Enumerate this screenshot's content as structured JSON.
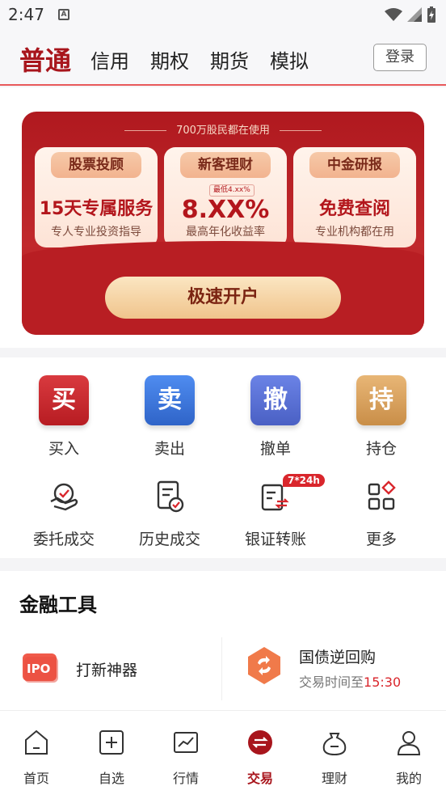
{
  "status_bar": {
    "time": "2:47",
    "notification_letter": "A"
  },
  "top_nav": {
    "tabs": [
      {
        "label": "普通",
        "active": true
      },
      {
        "label": "信用"
      },
      {
        "label": "期权"
      },
      {
        "label": "期货"
      },
      {
        "label": "模拟"
      }
    ],
    "login_label": "登录"
  },
  "banner": {
    "tagline": "700万股民都在使用",
    "cards": [
      {
        "title": "股票投顾",
        "main": "15天专属服务",
        "sub": "专人专业投资指导"
      },
      {
        "title": "新客理财",
        "mini": "最低4.xx%",
        "main": "8.XX%",
        "sub": "最高年化收益率"
      },
      {
        "title": "中金研报",
        "main": "免费查阅",
        "sub": "专业机构都在用"
      }
    ],
    "button_label": "极速开户"
  },
  "quick_actions": {
    "primary": [
      {
        "glyph": "买",
        "label": "买入",
        "color": "#c9232b"
      },
      {
        "glyph": "卖",
        "label": "卖出",
        "color": "#3f78d8"
      },
      {
        "glyph": "撤",
        "label": "撤单",
        "color": "#5b72d6"
      },
      {
        "glyph": "持",
        "label": "持仓",
        "color": "#d9a15c"
      }
    ],
    "secondary": [
      {
        "icon": "entrust-deal-icon",
        "label": "委托成交"
      },
      {
        "icon": "history-deal-icon",
        "label": "历史成交"
      },
      {
        "icon": "bank-transfer-icon",
        "label": "银证转账",
        "badge": "7*24h"
      },
      {
        "icon": "more-grid-icon",
        "label": "更多"
      }
    ]
  },
  "tools": {
    "title": "金融工具",
    "items": [
      {
        "icon": "ipo-icon",
        "label": "打新神器"
      },
      {
        "icon": "repo-icon",
        "label": "国债逆回购",
        "sub_prefix": "交易时间至",
        "sub_time": "15:30"
      }
    ]
  },
  "bottom_nav": [
    {
      "icon": "home-icon",
      "label": "首页"
    },
    {
      "icon": "watchlist-icon",
      "label": "自选"
    },
    {
      "icon": "market-icon",
      "label": "行情"
    },
    {
      "icon": "trade-icon",
      "label": "交易",
      "active": true
    },
    {
      "icon": "wealth-icon",
      "label": "理财"
    },
    {
      "icon": "profile-icon",
      "label": "我的"
    }
  ],
  "colors": {
    "brand": "#a8151c",
    "accent_red": "#d9262c"
  }
}
